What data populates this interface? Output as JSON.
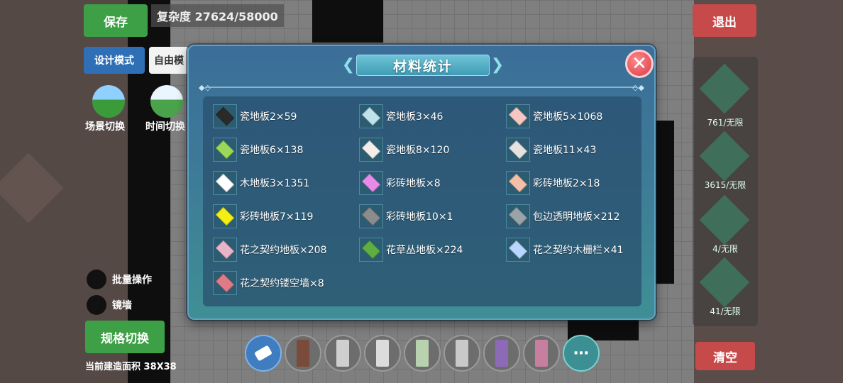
{
  "background": {
    "save_label": "保存",
    "complexity_text": "复杂度 27624/58000",
    "exit_label": "退出",
    "design_mode_label": "设计模式",
    "free_mode_label": "自由模",
    "scene_switch_label": "场景切换",
    "time_switch_label": "时间切换",
    "batch_label": "批量操作",
    "mirror_label": "镜墙",
    "spec_switch_label": "规格切换",
    "build_area_label": "当前建造面积 38X38",
    "clear_label": "清空",
    "side_counts": [
      "761/无限",
      "3615/无限",
      "4/无限",
      "41/无限"
    ]
  },
  "dialog": {
    "title": "材料统计",
    "close_icon": "close-x-icon",
    "items": [
      {
        "label": "瓷地板2×59",
        "color": "#2a2a2a"
      },
      {
        "label": "瓷地板3×46",
        "color": "#bfe3ea"
      },
      {
        "label": "瓷地板5×1068",
        "color": "#f6c6c2"
      },
      {
        "label": "瓷地板6×138",
        "color": "#9ad85a"
      },
      {
        "label": "瓷地板8×120",
        "color": "#f4eeea"
      },
      {
        "label": "瓷地板11×43",
        "color": "#e6e2df"
      },
      {
        "label": "木地板3×1351",
        "color": "#ffffff"
      },
      {
        "label": "彩砖地板×8",
        "color": "#e88ae8"
      },
      {
        "label": "彩砖地板2×18",
        "color": "#f2bfa9"
      },
      {
        "label": "彩砖地板7×119",
        "color": "#f3ee13"
      },
      {
        "label": "彩砖地板10×1",
        "color": "#8c8c8c"
      },
      {
        "label": "包边透明地板×212",
        "color": "#9aa3a8"
      },
      {
        "label": "花之契约地板×208",
        "color": "#e9b3c8"
      },
      {
        "label": "花草丛地板×224",
        "color": "#5fae42"
      },
      {
        "label": "花之契约木栅栏×41",
        "color": "#b9d6ff"
      },
      {
        "label": "花之契约镂空墙×8",
        "color": "#e07a86"
      }
    ]
  }
}
